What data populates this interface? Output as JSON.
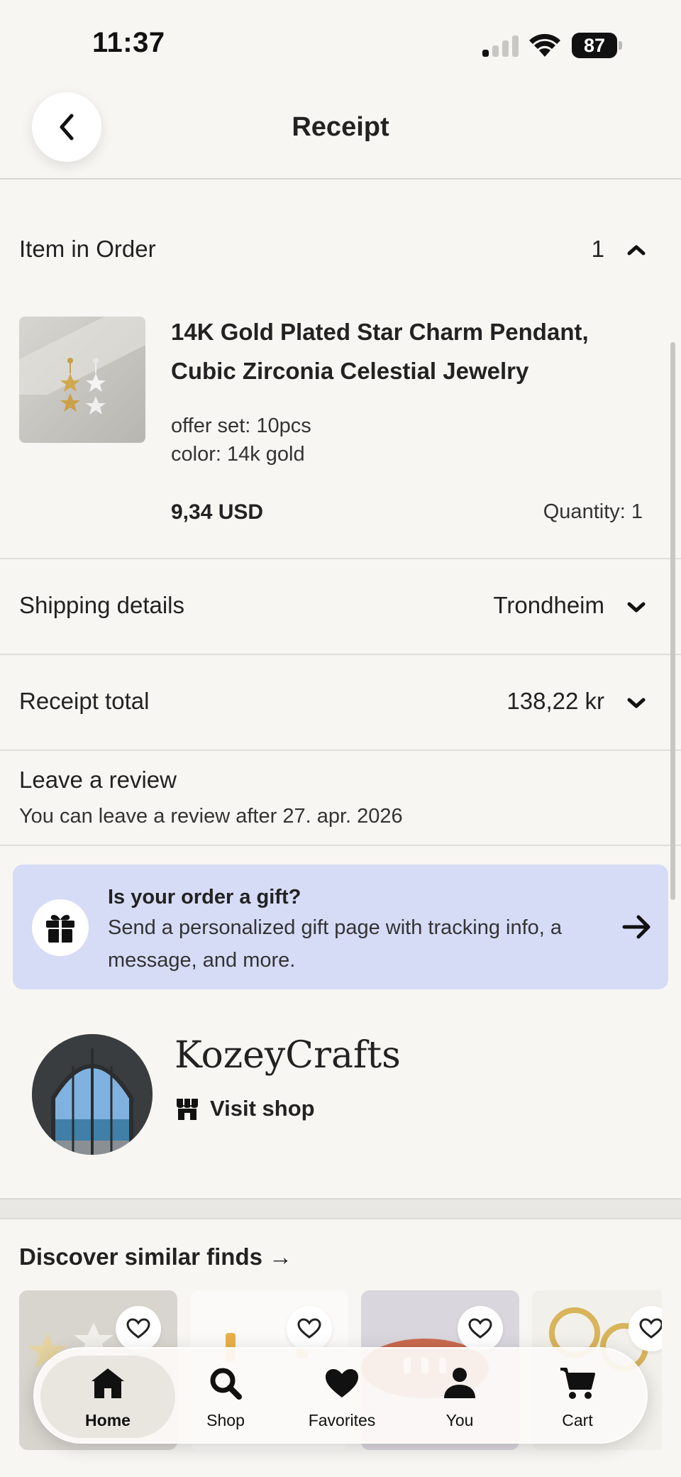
{
  "status_bar": {
    "time": "11:37",
    "battery": "87"
  },
  "header": {
    "title": "Receipt"
  },
  "order": {
    "label": "Item in Order",
    "count": "1",
    "item": {
      "title": "14K Gold Plated Star Charm Pendant, Cubic Zirconia Celestial Jewelry",
      "options": [
        "offer set: 10pcs",
        "color: 14k gold"
      ],
      "price": "9,34 USD",
      "quantity": "Quantity: 1"
    }
  },
  "shipping": {
    "label": "Shipping details",
    "value": "Trondheim"
  },
  "total": {
    "label": "Receipt total",
    "value": "138,22 kr"
  },
  "review": {
    "title": "Leave a review",
    "subtitle": "You can leave a review after 27. apr. 2026"
  },
  "gift": {
    "title": "Is your order a gift?",
    "body": "Send a personalized gift page with tracking info, a message, and more."
  },
  "shop": {
    "name": "KozeyCrafts",
    "visit_label": "Visit shop"
  },
  "discover": {
    "title": "Discover similar finds →"
  },
  "tabs": [
    {
      "label": "Home",
      "icon": "home-icon"
    },
    {
      "label": "Shop",
      "icon": "search-icon"
    },
    {
      "label": "Favorites",
      "icon": "heart-icon"
    },
    {
      "label": "You",
      "icon": "person-icon"
    },
    {
      "label": "Cart",
      "icon": "cart-icon"
    }
  ],
  "colors": {
    "background": "#f8f6f2",
    "gift_card": "#d6dcf6",
    "text": "#222222"
  }
}
